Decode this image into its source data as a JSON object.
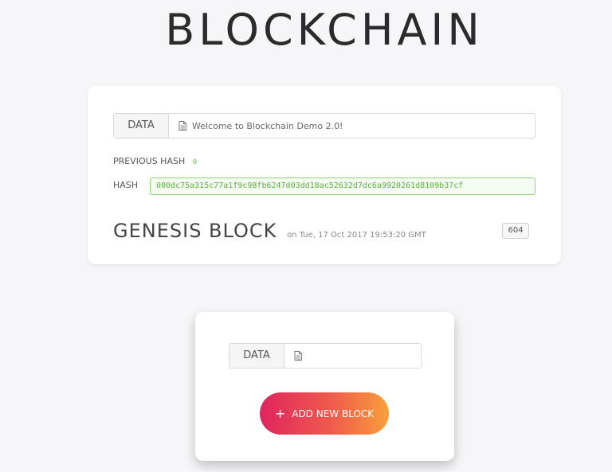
{
  "title": "BLOCKCHAIN",
  "genesis_block": {
    "data_label": "DATA",
    "data_value": "Welcome to Blockchain Demo 2.0!",
    "previous_hash_label": "PREVIOUS HASH",
    "previous_hash_value": "0",
    "hash_label": "HASH",
    "hash_value": "000dc75a315c77a1f9c98fb6247d03dd18ac52632d7dc6a9920261d8109b37cf",
    "block_name": "GENESIS BLOCK",
    "timestamp": "on Tue, 17 Oct 2017 19:53:20 GMT",
    "nonce": "604"
  },
  "new_block": {
    "data_label": "DATA",
    "data_value": "",
    "add_button_label": "ADD NEW BLOCK",
    "add_button_icon": "plus-icon"
  },
  "colors": {
    "hash_green": "#5bb23a",
    "button_gradient_start": "#e0245e",
    "button_gradient_end": "#f89f3b"
  }
}
